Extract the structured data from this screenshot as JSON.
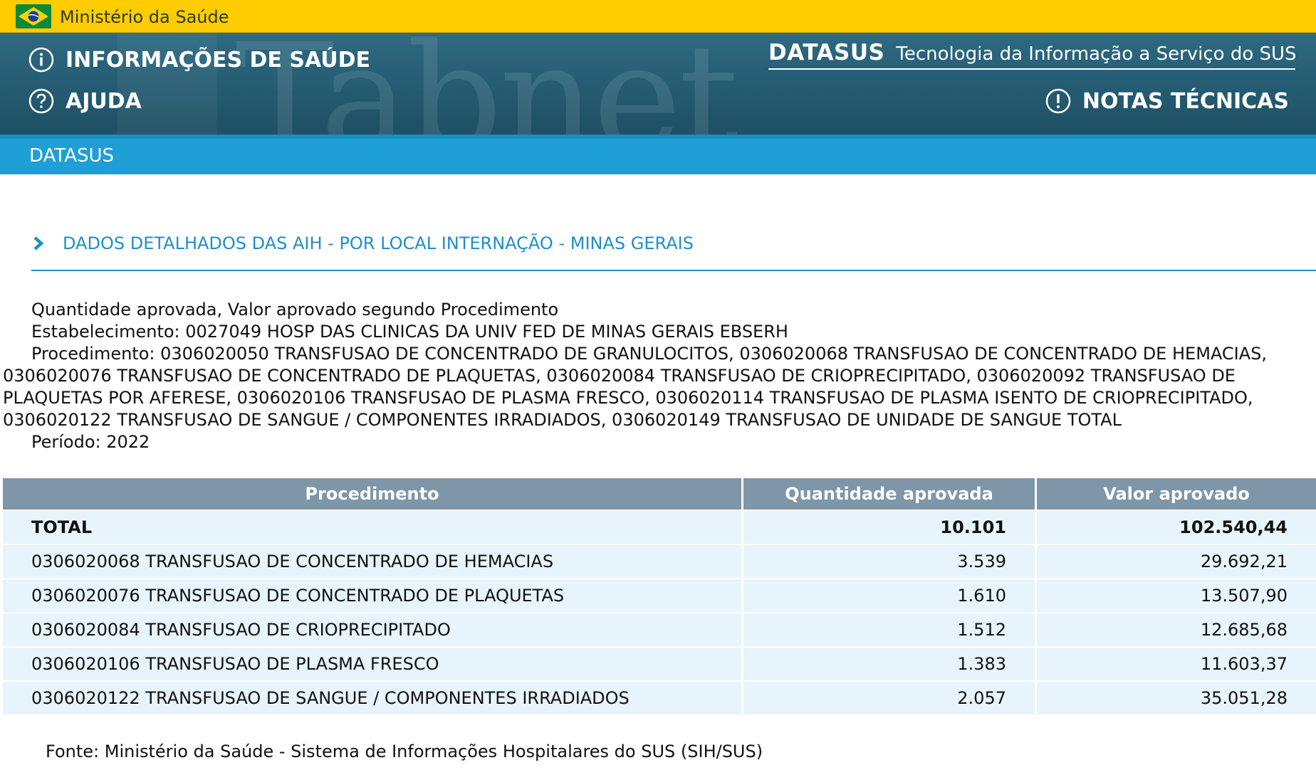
{
  "gov_bar": {
    "title": "Ministério da Saúde",
    "flag_icon": "brazil-flag-icon"
  },
  "header": {
    "watermark": "Tabnet",
    "links": {
      "informacoes": "INFORMAÇÕES DE SAÚDE",
      "ajuda": "AJUDA",
      "notas": "NOTAS TÉCNICAS"
    },
    "brand": {
      "name": "DATASUS",
      "tagline": "Tecnologia da Informação a Serviço do SUS"
    }
  },
  "datasus_bar": {
    "label": "DATASUS"
  },
  "section": {
    "title": "DADOS DETALHADOS DAS AIH - POR LOCAL INTERNAÇÃO - MINAS GERAIS"
  },
  "description": {
    "heading": "Quantidade aprovada, Valor aprovado segundo Procedimento",
    "estabelecimento_label": "Estabelecimento:",
    "estabelecimento_value": "0027049 HOSP DAS CLINICAS DA UNIV FED DE MINAS GERAIS EBSERH",
    "procedimento_label": "Procedimento:",
    "procedimento_value": "0306020050 TRANSFUSAO DE CONCENTRADO DE GRANULOCITOS, 0306020068 TRANSFUSAO DE CONCENTRADO DE HEMACIAS, 0306020076 TRANSFUSAO DE CONCENTRADO DE PLAQUETAS, 0306020084 TRANSFUSAO DE CRIOPRECIPITADO, 0306020092 TRANSFUSAO DE PLAQUETAS POR AFERESE, 0306020106 TRANSFUSAO DE PLASMA FRESCO, 0306020114 TRANSFUSAO DE PLASMA ISENTO DE CRIOPRECIPITADO, 0306020122 TRANSFUSAO DE SANGUE / COMPONENTES IRRADIADOS, 0306020149 TRANSFUSAO DE UNIDADE DE SANGUE TOTAL",
    "periodo_label": "Período:",
    "periodo_value": "2022"
  },
  "table": {
    "headers": [
      "Procedimento",
      "Quantidade aprovada",
      "Valor aprovado"
    ],
    "total": {
      "procedimento": "TOTAL",
      "quantidade": "10.101",
      "valor": "102.540,44"
    },
    "rows": [
      {
        "procedimento": "0306020068 TRANSFUSAO DE CONCENTRADO DE HEMACIAS",
        "quantidade": "3.539",
        "valor": "29.692,21"
      },
      {
        "procedimento": "0306020076 TRANSFUSAO DE CONCENTRADO DE PLAQUETAS",
        "quantidade": "1.610",
        "valor": "13.507,90"
      },
      {
        "procedimento": "0306020084 TRANSFUSAO DE CRIOPRECIPITADO",
        "quantidade": "1.512",
        "valor": "12.685,68"
      },
      {
        "procedimento": "0306020106 TRANSFUSAO DE PLASMA FRESCO",
        "quantidade": "1.383",
        "valor": "11.603,37"
      },
      {
        "procedimento": "0306020122 TRANSFUSAO DE SANGUE / COMPONENTES IRRADIADOS",
        "quantidade": "2.057",
        "valor": "35.051,28"
      }
    ]
  },
  "footer": {
    "fonte": "Fonte: Ministério da Saúde - Sistema de Informações Hospitalares do SUS (SIH/SUS)"
  },
  "colors": {
    "gov_yellow": "#ffcc00",
    "header_teal": "#245a70",
    "datasus_blue": "#1e9fd6",
    "section_blue": "#1e8fc7",
    "table_header": "#7e96a8",
    "table_row": "#e8f4fb"
  }
}
